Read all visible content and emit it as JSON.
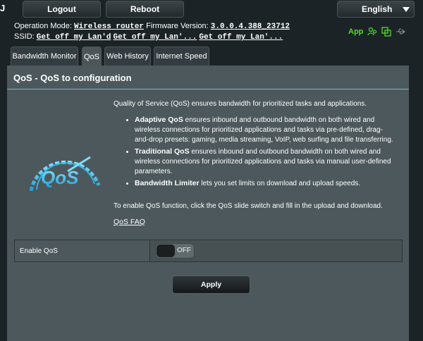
{
  "header": {
    "edge_letter": "J",
    "logout_label": "Logout",
    "reboot_label": "Reboot",
    "language": "English"
  },
  "info": {
    "operation_mode_label": "Operation Mode:",
    "operation_mode_value": "Wireless router",
    "firmware_label": "Firmware Version:",
    "firmware_value": "3.0.0.4.388_23712",
    "ssid_label": "SSID:",
    "ssids": [
      "Get off my Lan'd",
      "Get off my Lan'...",
      "Get off my Lan'..."
    ]
  },
  "status": {
    "app_label": "App",
    "accent": "#4fdd2a"
  },
  "tabs": [
    {
      "label": "Bandwidth Monitor"
    },
    {
      "label": "QoS"
    },
    {
      "label": "Web History"
    },
    {
      "label": "Internet Speed"
    }
  ],
  "panel": {
    "title": "QoS - QoS to configuration",
    "intro": "Quality of Service (QoS) ensures bandwidth for prioritized tasks and applications.",
    "bullets": [
      {
        "bold": "Adaptive QoS",
        "text": " ensures inbound and outbound bandwidth on both wired and wireless connections for prioritized applications and tasks via pre-defined, drag-and-drop presets: gaming, media streaming, VoIP, web surfing and file transferring."
      },
      {
        "bold": "Traditional QoS",
        "text": " ensures inbound and outbound bandwidth on both wired and wireless connections for prioritized applications and tasks via manual user-defined parameters."
      },
      {
        "bold": "Bandwidth Limiter",
        "text": " lets you set limits on download and upload speeds."
      }
    ],
    "enable_instructions": "To enable QoS function, click the QoS slide switch and fill in the upload and download.",
    "faq_label": "QoS FAQ",
    "logo_text": "QoS"
  },
  "settings": {
    "enable_label": "Enable QoS",
    "toggle_state": "OFF"
  },
  "apply_label": "Apply"
}
